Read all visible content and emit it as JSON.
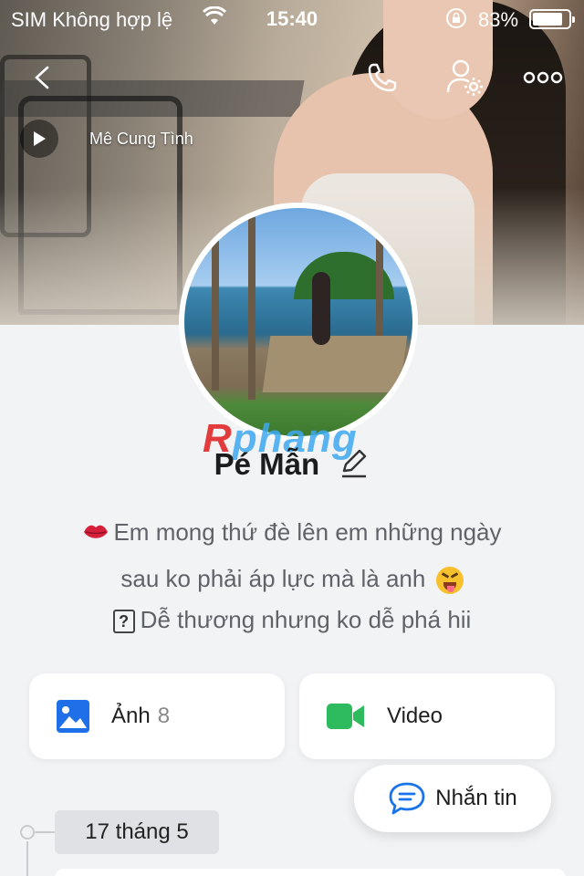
{
  "status_bar": {
    "carrier": "SIM Không hợp lệ",
    "time": "15:40",
    "battery": "83%",
    "battery_level": 0.83
  },
  "header": {
    "music_title": "Mê Cung Tình"
  },
  "profile": {
    "name": "Pé Mẫn",
    "watermark_r": "R",
    "watermark_rest": "phang",
    "bio_line1": "Em mong thứ đè lên em những ngày",
    "bio_line2": "sau ko phải áp lực mà là anh",
    "bio_line3": "Dễ thương nhưng ko dễ phá hii",
    "bio_box_glyph": "?"
  },
  "cards": {
    "photo_label": "Ảnh",
    "photo_count": "8",
    "video_label": "Video"
  },
  "actions": {
    "message_label": "Nhắn tin"
  },
  "timeline": {
    "date": "17 tháng 5"
  },
  "icons": {
    "back": "chevron-left-icon",
    "call": "phone-icon",
    "settings": "user-gear-icon",
    "more": "more-horizontal-icon",
    "play": "play-icon",
    "edit": "pencil-icon",
    "photo": "image-icon",
    "video": "video-camera-icon",
    "message": "chat-bubble-icon"
  },
  "colors": {
    "accent_blue": "#1a73e8",
    "video_green": "#2dbb5d",
    "photo_blue": "#1e6fe8"
  }
}
